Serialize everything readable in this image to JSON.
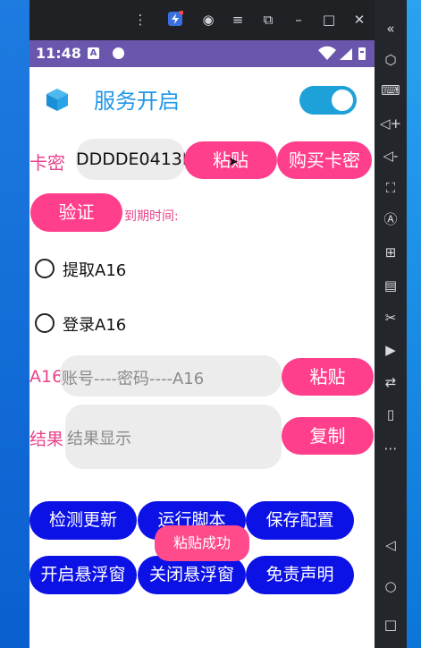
{
  "emulator": {
    "titlebar_icons": [
      "more-vert-icon",
      "lightning-icon",
      "user-circle-icon",
      "menu-icon",
      "popout-icon",
      "minimize-icon",
      "maximize-icon",
      "close-icon"
    ],
    "collapse_glyph": "«"
  },
  "status_bar": {
    "time": "11:48",
    "badge": "A"
  },
  "header": {
    "title": "服务开启",
    "toggle_on": true
  },
  "card_key": {
    "label": "卡密",
    "value": "DDDDE0413D",
    "paste_button": "粘贴",
    "buy_button": "购买卡密"
  },
  "verify": {
    "button": "验证",
    "expiry_label": "到期时间:"
  },
  "options": {
    "extract": "提取A16",
    "login": "登录A16"
  },
  "a16": {
    "label": "A16",
    "placeholder": "账号----密码----A16",
    "paste_button": "粘贴"
  },
  "result": {
    "label": "结果",
    "placeholder": "结果显示",
    "copy_button": "复制"
  },
  "actions": {
    "check_update": "检测更新",
    "run_script": "运行脚本",
    "save_config": "保存配置",
    "open_float": "开启悬浮窗",
    "close_float": "关闭悬浮窗",
    "disclaimer": "免责声明"
  },
  "toast": "粘贴成功",
  "colors": {
    "accent_pink": "#ff3f8b",
    "button_blue": "#0c11e6",
    "status_bar": "#6a56ad",
    "title_blue": "#2196e8"
  }
}
